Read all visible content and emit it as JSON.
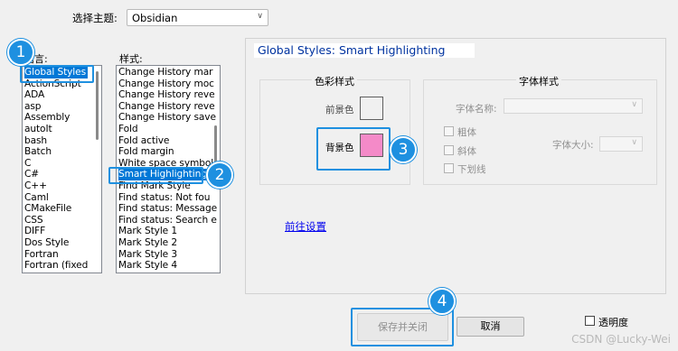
{
  "theme": {
    "label": "选择主题:",
    "selected": "Obsidian"
  },
  "language_list": {
    "title": "语言:",
    "items": [
      "Global Styles",
      "ActionScript",
      "ADA",
      "asp",
      "Assembly",
      "autoIt",
      "bash",
      "Batch",
      "C",
      "C#",
      "C++",
      "Caml",
      "CMakeFile",
      "CSS",
      "DIFF",
      "Dos Style",
      "Fortran",
      "Fortran (fixed"
    ],
    "selected_index": 0
  },
  "style_list": {
    "title": "样式:",
    "items": [
      "Change History mar",
      "Change History moc",
      "Change History reve",
      "Change History reve",
      "Change History save",
      "Fold",
      "Fold active",
      "Fold margin",
      "White space symbol",
      "Smart Highlighting",
      "Find Mark Style",
      "Find status: Not fou",
      "Find status: Message",
      "Find status: Search e",
      "Mark Style 1",
      "Mark Style 2",
      "Mark Style 3",
      "Mark Style 4"
    ],
    "selected_index": 9
  },
  "panel": {
    "title": "Global Styles: Smart Highlighting"
  },
  "colour_group": {
    "title": "色彩样式",
    "foreground_label": "前景色",
    "background_label": "背景色",
    "foreground_color": "#f0f0f0",
    "background_color": "#f48ac8"
  },
  "font_group": {
    "title": "字体样式",
    "font_name_label": "字体名称:",
    "bold_label": "粗体",
    "italic_label": "斜体",
    "underline_label": "下划线",
    "font_size_label": "字体大小:"
  },
  "goto_settings_link": "前往设置",
  "buttons": {
    "save_close": "保存并关闭",
    "cancel": "取消"
  },
  "transparency_label": "透明度",
  "annotations": [
    "1",
    "2",
    "3",
    "4"
  ],
  "watermark": "CSDN @Lucky-Wei",
  "colors": {
    "highlight": "#1e90e0",
    "selection": "#0078d7",
    "link": "#0000ee",
    "panel_title": "#0033a0"
  }
}
